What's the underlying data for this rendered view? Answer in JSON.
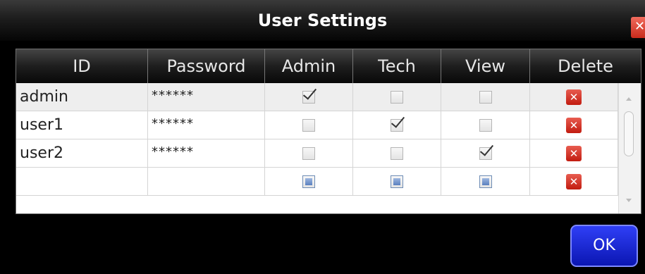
{
  "window": {
    "title": "User Settings",
    "close_label": "✕"
  },
  "table": {
    "columns": [
      "ID",
      "Password",
      "Admin",
      "Tech",
      "View",
      "Delete"
    ],
    "rows": [
      {
        "id": "admin",
        "password": "******",
        "admin": "checked",
        "tech": "unchecked",
        "view": "unchecked",
        "delete": "✕",
        "selected": true
      },
      {
        "id": "user1",
        "password": "******",
        "admin": "unchecked",
        "tech": "checked",
        "view": "unchecked",
        "delete": "✕",
        "selected": false
      },
      {
        "id": "user2",
        "password": "******",
        "admin": "unchecked",
        "tech": "unchecked",
        "view": "checked",
        "delete": "✕",
        "selected": false
      },
      {
        "id": "",
        "password": "",
        "admin": "indeterminate",
        "tech": "indeterminate",
        "view": "indeterminate",
        "delete": "✕",
        "selected": false
      }
    ]
  },
  "buttons": {
    "ok_label": "OK"
  },
  "colors": {
    "ok_button": "#1a28d8",
    "delete_button": "#d0281b",
    "header": "#1e1e1e"
  }
}
